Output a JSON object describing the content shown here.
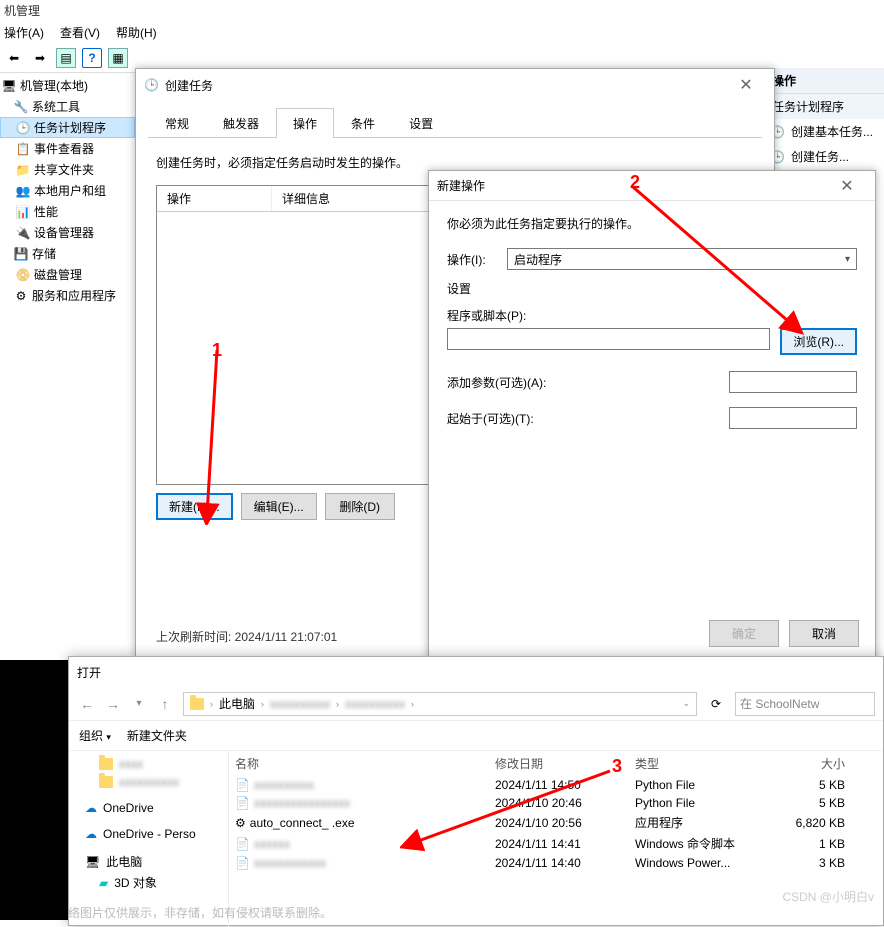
{
  "app_title": "机管理",
  "menu": {
    "action": "操作(A)",
    "view": "查看(V)",
    "help": "帮助(H)"
  },
  "tree": {
    "root": "机管理(本地)",
    "sys_tools": "系统工具",
    "task_sched": "任务计划程序",
    "event_viewer": "事件查看器",
    "shared": "共享文件夹",
    "users": "本地用户和组",
    "perf": "性能",
    "devmgr": "设备管理器",
    "storage": "存储",
    "diskmgr": "磁盘管理",
    "services": "服务和应用程序"
  },
  "right_panel": {
    "header": "操作",
    "sub": "任务计划程序",
    "create_basic": "创建基本任务...",
    "create_task": "创建任务..."
  },
  "dlg1": {
    "title": "创建任务",
    "tabs": {
      "general": "常规",
      "triggers": "触发器",
      "actions": "操作",
      "conditions": "条件",
      "settings": "设置"
    },
    "instruction": "创建任务时，必须指定任务启动时发生的操作。",
    "col_op": "操作",
    "col_detail": "详细信息",
    "btn_new": "新建(N)...",
    "btn_edit": "编辑(E)...",
    "btn_delete": "删除(D)",
    "refresh_time": "上次刷新时间: 2024/1/11 21:07:01"
  },
  "dlg2": {
    "title": "新建操作",
    "instruction": "你必须为此任务指定要执行的操作。",
    "action_label": "操作(I):",
    "action_value": "启动程序",
    "settings_label": "设置",
    "prog_label": "程序或脚本(P):",
    "browse": "浏览(R)...",
    "args_label": "添加参数(可选)(A):",
    "startin_label": "起始于(可选)(T):",
    "ok": "确定",
    "cancel": "取消"
  },
  "opendlg": {
    "title": "打开",
    "this_pc": "此电脑",
    "search_placeholder": "在 SchoolNetw",
    "organize": "组织",
    "new_folder": "新建文件夹",
    "sidebar": {
      "onedrive": "OneDrive",
      "onedrive_p": "OneDrive - Perso",
      "this_pc": "此电脑",
      "objects3d": "3D 对象"
    },
    "hdr": {
      "name": "名称",
      "date": "修改日期",
      "type": "类型",
      "size": "大小"
    },
    "files": [
      {
        "name": "",
        "date": "2024/1/11 14:50",
        "type": "Python File",
        "size": "5 KB"
      },
      {
        "name": "",
        "date": "2024/1/10 20:46",
        "type": "Python File",
        "size": "5 KB"
      },
      {
        "name": "auto_connect_    .exe",
        "date": "2024/1/10 20:56",
        "type": "应用程序",
        "size": "6,820 KB"
      },
      {
        "name": "",
        "date": "2024/1/11 14:41",
        "type": "Windows 命令脚本",
        "size": "1 KB"
      },
      {
        "name": "",
        "date": "2024/1/11 14:40",
        "type": "Windows Power...",
        "size": "3 KB"
      }
    ]
  },
  "annotations": {
    "n1": "1",
    "n2": "2",
    "n3": "3"
  },
  "watermark": "CSDN @小明白v",
  "disclaimer": "      络图片仅供展示，非存储，如有侵权请联系删除。"
}
